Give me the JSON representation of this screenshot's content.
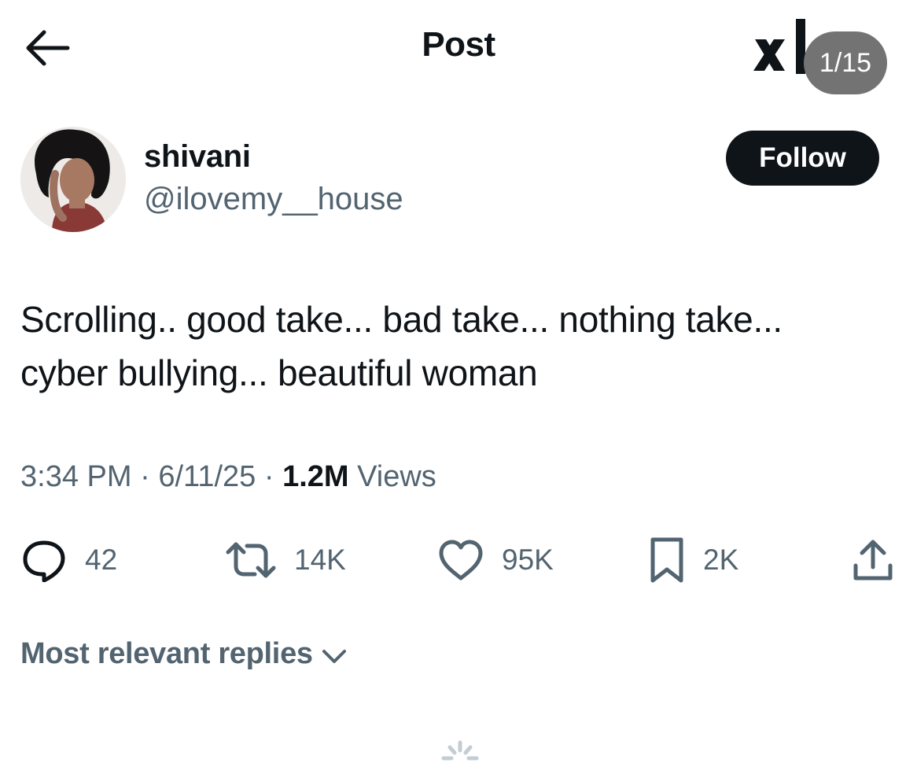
{
  "header": {
    "title": "Post",
    "media_counter": "1/15",
    "icons": {
      "back": "arrow-left-icon",
      "logo": "xai-logo-icon"
    }
  },
  "author": {
    "display_name": "shivani",
    "handle": "@ilovemy__house",
    "follow_label": "Follow"
  },
  "post": {
    "text_line1": "Scrolling.. good take... bad take... nothing take...",
    "text_line2": "cyber bullying... beautiful woman",
    "time": "3:34 PM",
    "sep1": "·",
    "date": "6/11/25",
    "sep2": "·",
    "views_count": "1.2M",
    "views_label": "Views"
  },
  "actions": {
    "replies": "42",
    "reposts": "14K",
    "likes": "95K",
    "bookmarks": "2K",
    "icons": [
      "reply-icon",
      "repost-icon",
      "like-icon",
      "bookmark-icon",
      "share-icon"
    ]
  },
  "replies_sort": {
    "label": "Most relevant replies"
  },
  "colors": {
    "text": "#0f1419",
    "secondary": "#536471",
    "button": "#0f1419",
    "counter_bg": "#737373"
  }
}
